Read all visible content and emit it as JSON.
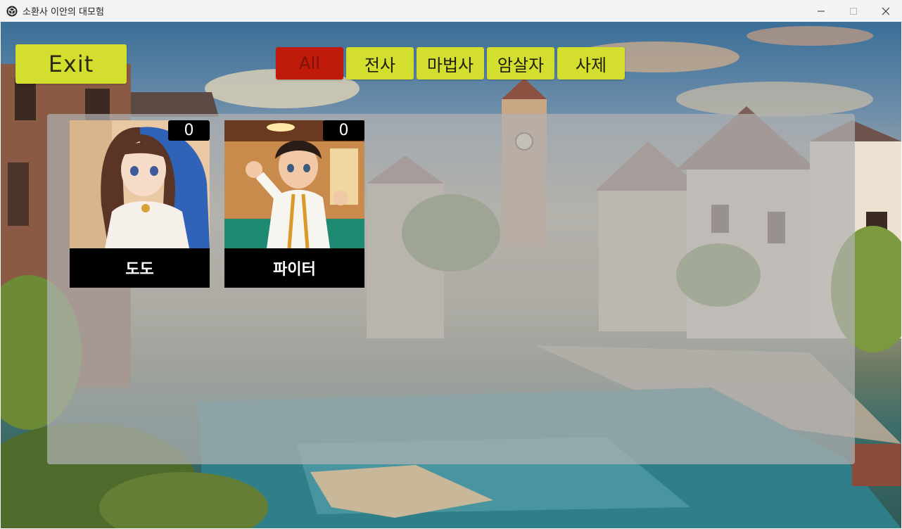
{
  "window": {
    "title": "소환사 이안의 대모험",
    "icon": "unity-cube-icon",
    "controls": [
      "minimize-icon",
      "maximize-icon",
      "close-icon"
    ]
  },
  "toolbar": {
    "exit_label": "Exit"
  },
  "filters": {
    "tabs": [
      {
        "label": "All",
        "active": true
      },
      {
        "label": "전사",
        "active": false
      },
      {
        "label": "마법사",
        "active": false
      },
      {
        "label": "암살자",
        "active": false
      },
      {
        "label": "사제",
        "active": false
      }
    ]
  },
  "characters": [
    {
      "name": "도도",
      "count": "0"
    },
    {
      "name": "파이터",
      "count": "0"
    }
  ],
  "colors": {
    "button_yellow": "#d4de2e",
    "active_red": "#c01a0a",
    "panel_gray": "#b2b2b2",
    "card_black": "#000000"
  }
}
